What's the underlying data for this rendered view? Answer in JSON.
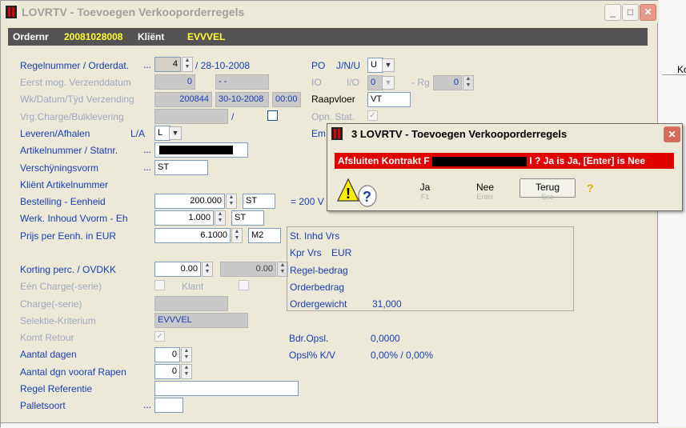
{
  "window": {
    "title": "LOVRTV - Toevoegen Verkooporderregels",
    "min": "_",
    "max": "□",
    "close": "✕"
  },
  "header": {
    "ordernr_label": "Ordernr",
    "ordernr_value": "20081028008",
    "client_label": "Kliënt",
    "client_value": "EVVVEL"
  },
  "form": {
    "regelnummer_label": "Regelnummer / Orderdat.",
    "regelnummer_value": "4",
    "orderdat": "/ 28-10-2008",
    "eerst_label": "Eerst mog. Verzenddatum",
    "eerst_value": "0",
    "eerst_date": "- -",
    "wk_label": "Wk/Datum/Tÿd Verzending",
    "wk_value": "200844",
    "wk_date": "30-10-2008",
    "wk_time": "00:00",
    "vrg_label": "Vrg.Charge/Bulklevering",
    "vrg_slash": "/",
    "leveren_label": "Leveren/Afhalen",
    "leveren_sub": "L/A",
    "leveren_value": "L",
    "artikel_label": "Artikelnummer / Statnr.",
    "verschijn_label": "Verschÿningsvorm",
    "verschijn_value": "ST",
    "klient_art_label": "Kliënt Artikelnummer",
    "bestelling_label": "Bestelling - Eenheid",
    "bestelling_value": "200.000",
    "bestelling_unit": "ST",
    "bestelling_eq": "= 200 V",
    "werk_label": "Werk. Inhoud Vvorm - Eh",
    "werk_value": "1.000",
    "werk_unit": "ST",
    "prijs_label": "Prijs per Eenh. in EUR",
    "prijs_value": "6.1000",
    "prijs_unit": "M2",
    "korting_label": "Korting perc. / OVDKK",
    "korting_value": "0.00",
    "korting_value2": "0.00",
    "een_charge_label": "Eén Charge(-serie)",
    "klant_label": "Klant",
    "charge_label": "Charge(-serie)",
    "selectie_label": "Selektie-Kriterium",
    "selectie_value": "EVVVEL",
    "komt_label": "Komt Retour",
    "aantal_label": "Aantal dagen",
    "aantal_value": "0",
    "aantal_rapen_label": "Aantal dgn vooraf Rapen",
    "aantal_rapen_value": "0",
    "regel_ref_label": "Regel Referentie",
    "pallet_label": "Palletsoort",
    "po_label": "PO",
    "po_sub": "J/N/U",
    "po_value": "U",
    "io_label": "IO",
    "io_sub": "I/O",
    "io_value": "0",
    "rg_label": "- Rg",
    "rg_value": "0",
    "raap_label": "Raapvloer",
    "raap_value": "VT",
    "opn_label": "Opn. Stat.",
    "em_label": "Em",
    "ellipsis": "..."
  },
  "info": {
    "st_inhd": "St. Inhd Vrs",
    "kpr": "Kpr Vrs",
    "kpr_cur": "EUR",
    "regel": "Regel-bedrag",
    "orderbedrag": "Orderbedrag",
    "ordergewicht": "Ordergewicht",
    "ordergewicht_value": "31,000",
    "bdr_label": "Bdr.Opsl.",
    "bdr_value": "0,0000",
    "opsl_label": "Opsl% K/V",
    "opsl_value": "0,00% / 0,00%"
  },
  "right_panel": {
    "col": "Ko"
  },
  "dialog": {
    "title": "3 LOVRTV - Toevoegen Verkooporderregels",
    "msg_left": "Afsluiten Kontrakt F",
    "msg_right": "I ? Ja is Ja, [Enter] is Nee",
    "ja": "Ja",
    "ja_key": "F1",
    "nee": "Nee",
    "nee_key": "Enter",
    "terug": "Terug",
    "terug_key": "Esc",
    "help": "?"
  },
  "colors": {
    "label_blue": "#1a3db0",
    "header_yellow": "#ffff33",
    "dialog_red": "#e00000"
  }
}
